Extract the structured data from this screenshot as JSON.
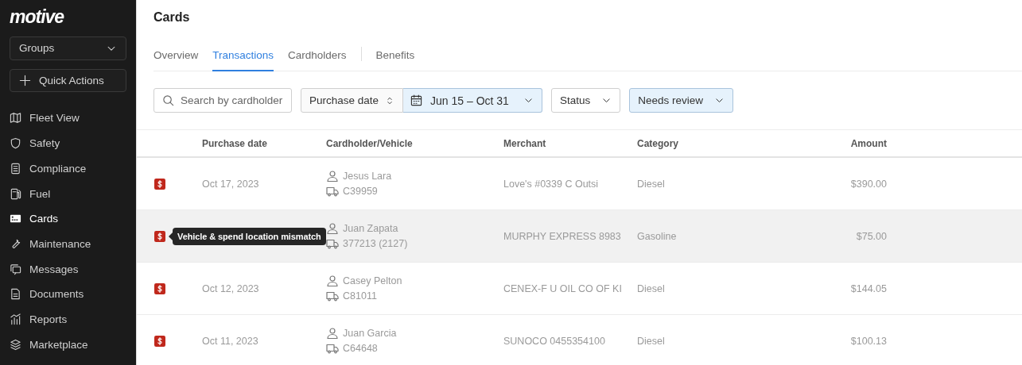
{
  "sidebar": {
    "logo": "motive",
    "groups_select": {
      "label": "Groups"
    },
    "quick_actions": {
      "label": "Quick Actions"
    },
    "items": [
      {
        "label": "Fleet View",
        "selected": false
      },
      {
        "label": "Safety",
        "selected": false
      },
      {
        "label": "Compliance",
        "selected": false
      },
      {
        "label": "Fuel",
        "selected": false
      },
      {
        "label": "Cards",
        "selected": true
      },
      {
        "label": "Maintenance",
        "selected": false
      },
      {
        "label": "Messages",
        "selected": false
      },
      {
        "label": "Documents",
        "selected": false
      },
      {
        "label": "Reports",
        "selected": false
      },
      {
        "label": "Marketplace",
        "selected": false
      }
    ]
  },
  "page": {
    "title": "Cards",
    "tabs": [
      {
        "label": "Overview",
        "selected": false,
        "separated": false
      },
      {
        "label": "Transactions",
        "selected": true,
        "separated": false
      },
      {
        "label": "Cardholders",
        "selected": false,
        "separated": false
      },
      {
        "label": "Benefits",
        "selected": false,
        "separated": true
      }
    ],
    "filters": [
      {
        "kind": "search",
        "placeholder": "Search by cardholder",
        "active": false
      },
      {
        "kind": "sort",
        "label": "Purchase date",
        "active": false
      },
      {
        "kind": "date",
        "label": "Jun 15 – Oct 31",
        "active": true
      },
      {
        "kind": "select",
        "label": "Status",
        "active": false
      },
      {
        "kind": "select",
        "label": "Needs review",
        "active": true
      }
    ]
  },
  "table": {
    "columns": [
      "Purchase date",
      "Cardholder/Vehicle",
      "Merchant",
      "Category",
      "Amount"
    ],
    "rows": [
      {
        "date": "Oct 17, 2023",
        "cardholder": "Jesus Lara",
        "vehicle": "C39959",
        "merchant": "Love's #0339 C Outsi",
        "category": "Diesel",
        "amount": "$390.00",
        "hovered": false
      },
      {
        "cardholder": "Juan Zapata",
        "vehicle": "377213 (2127)",
        "merchant": "MURPHY EXPRESS 8983",
        "category": "Gasoline",
        "amount": "$75.00",
        "hovered": true,
        "tooltip": "Vehicle & spend location mismatch"
      },
      {
        "date": "Oct 12, 2023",
        "cardholder": "Casey Pelton",
        "vehicle": "C81011",
        "merchant": "CENEX-F U OIL CO OF KI",
        "category": "Diesel",
        "amount": "$144.05",
        "hovered": false
      },
      {
        "date": "Oct 11, 2023",
        "cardholder": "Juan Garcia",
        "vehicle": "C64648",
        "merchant": "SUNOCO 0455354100",
        "category": "Diesel",
        "amount": "$100.13",
        "hovered": false
      }
    ]
  }
}
